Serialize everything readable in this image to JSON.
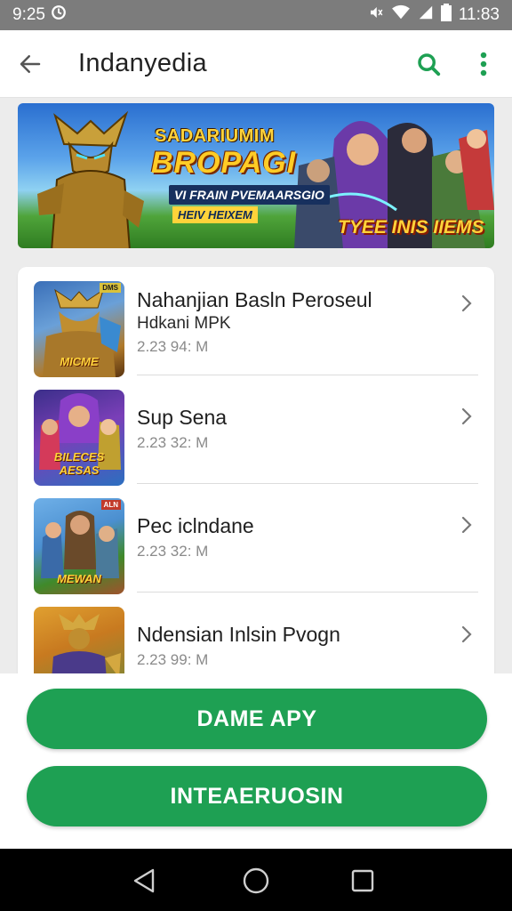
{
  "status_bar": {
    "time": "9:25",
    "clock_right": "11:83",
    "icons": [
      "sync-icon",
      "mute-icon",
      "wifi-icon",
      "signal-icon",
      "battery-icon"
    ]
  },
  "app_bar": {
    "title": "Indanyedia",
    "icons": [
      "back-arrow-icon",
      "search-icon",
      "more-vert-icon"
    ]
  },
  "banner": {
    "title": "SADARIUMIM",
    "headline": "BROPAGI",
    "subtitle": "VI FRAIN PVEMAARSGIO",
    "tag": "HEIV HEIXEM",
    "badge": "TYEE INIS IIEMS"
  },
  "list": {
    "items": [
      {
        "title": "Nahanjian Basln Peroseul",
        "subtitle": "Hdkani MPK",
        "meta": "2.23 94: M",
        "thumb_label": "MICME",
        "thumb_badge": "DMS"
      },
      {
        "title": "Sup Sena",
        "subtitle": "",
        "meta": "2.23 32: M",
        "thumb_label": "BILECES AESAS",
        "thumb_badge": ""
      },
      {
        "title": "Pec iclndane",
        "subtitle": "",
        "meta": "2.23 32: M",
        "thumb_label": "MEWAN",
        "thumb_badge": "ALN"
      },
      {
        "title": "Ndensian Inlsin Pvogn",
        "subtitle": "",
        "meta": "2.23 99: M",
        "thumb_label": "",
        "thumb_badge": ""
      }
    ]
  },
  "actions": {
    "primary_label": "DAME APY",
    "secondary_label": "INTEAERUOSIN"
  },
  "colors": {
    "accent": "#1ea053",
    "status_bar": "#7c7c7c",
    "nav_bar": "#000000",
    "background": "#ececec"
  },
  "nav_bar": {
    "icons": [
      "back-triangle-icon",
      "home-circle-icon",
      "recents-square-icon"
    ]
  }
}
